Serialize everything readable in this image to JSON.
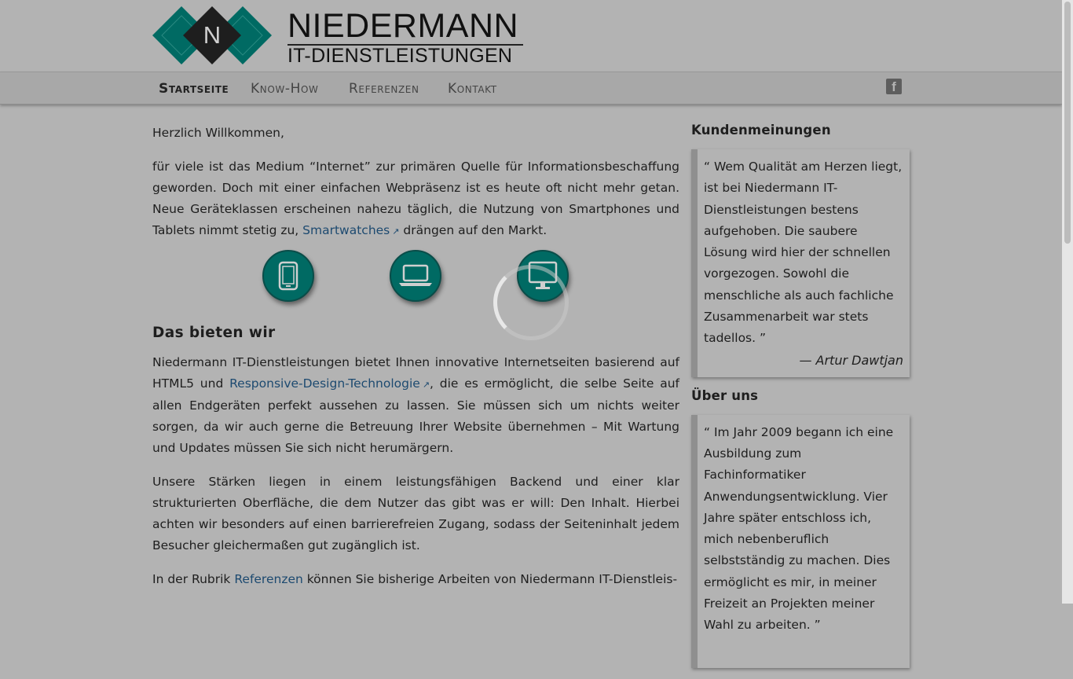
{
  "brand": {
    "logo_letter": "N",
    "title": "NIEDERMANN",
    "subtitle": "IT-DIENSTLEISTUNGEN",
    "colors": {
      "teal": "#006a63",
      "dark": "#1e1e1e"
    }
  },
  "nav": {
    "items": [
      {
        "label": "Startseite",
        "active": true
      },
      {
        "label": "Know-How"
      },
      {
        "label": "Referenzen"
      },
      {
        "label": "Kontakt"
      }
    ],
    "social_icon": "facebook-icon"
  },
  "main": {
    "greeting": "Herzlich Willkommen,",
    "intro_before_link": "für viele ist das Medium “Internet” zur primären Quelle für Informationsbeschaffung geworden. Doch mit einer einfachen Webpräsenz ist es heute oft nicht mehr getan. Neue Geräteklassen erscheinen nahezu täglich, die Nutzung von Smartphones und Tablets nimmt stetig zu, ",
    "intro_link": "Smartwatches",
    "intro_after_link": " drängen auf den Markt.",
    "device_icons": [
      "smartphone-icon",
      "laptop-icon",
      "monitor-icon"
    ],
    "section_title": "Das bieten wir",
    "offer_before_link": "Niedermann IT-Dienstleistungen bietet Ihnen innovative Internetseiten basierend auf HTML5 und ",
    "offer_link": "Responsive-Design-Technologie",
    "offer_after_link": ", die es ermöglicht, die selbe Seite auf allen Endgeräten perfekt aussehen zu lassen. Sie müssen sich um nichts weiter sorgen, da wir auch gerne die Betreuung Ihrer Website übernehmen – Mit Wartung und Updates müssen Sie sich nicht herumärgern.",
    "strengths": "Unsere Stärken liegen in einem leistungsfähigen Backend und einer klar strukturierten Oberfläche, die dem Nutzer das gibt was er will: Den Inhalt. Hierbei achten wir besonders auf einen barrierefreien Zugang, sodass der Seiteninhalt jedem Besucher gleichermaßen gut zugänglich ist.",
    "rubrik_before_link": "In der Rubrik ",
    "rubrik_link": "Referenzen",
    "rubrik_after_link": " können Sie bisherige Arbeiten von Niedermann IT-Dienstleis-"
  },
  "sidebar": {
    "reviews_title": "Kundenmeinungen",
    "review_text": "“ Wem Qualität am Herzen liegt, ist bei Niedermann IT-Dienstleistungen bestens aufgehoben. Die saubere Lösung wird hier der schnellen vorgezogen. Sowohl die menschliche als auch fachliche Zusammenarbeit war stets tadellos. ”",
    "review_author": "— Artur Dawtjan",
    "about_title": "Über uns",
    "about_text": "“ Im Jahr 2009 begann ich eine Ausbildung zum Fachinformatiker Anwendungsentwicklung. Vier Jahre später entschloss ich, mich nebenberuflich selbstständig zu machen. Dies ermöglicht es mir, in meiner Freizeit an Projekten meiner Wahl zu arbeiten. ”"
  }
}
